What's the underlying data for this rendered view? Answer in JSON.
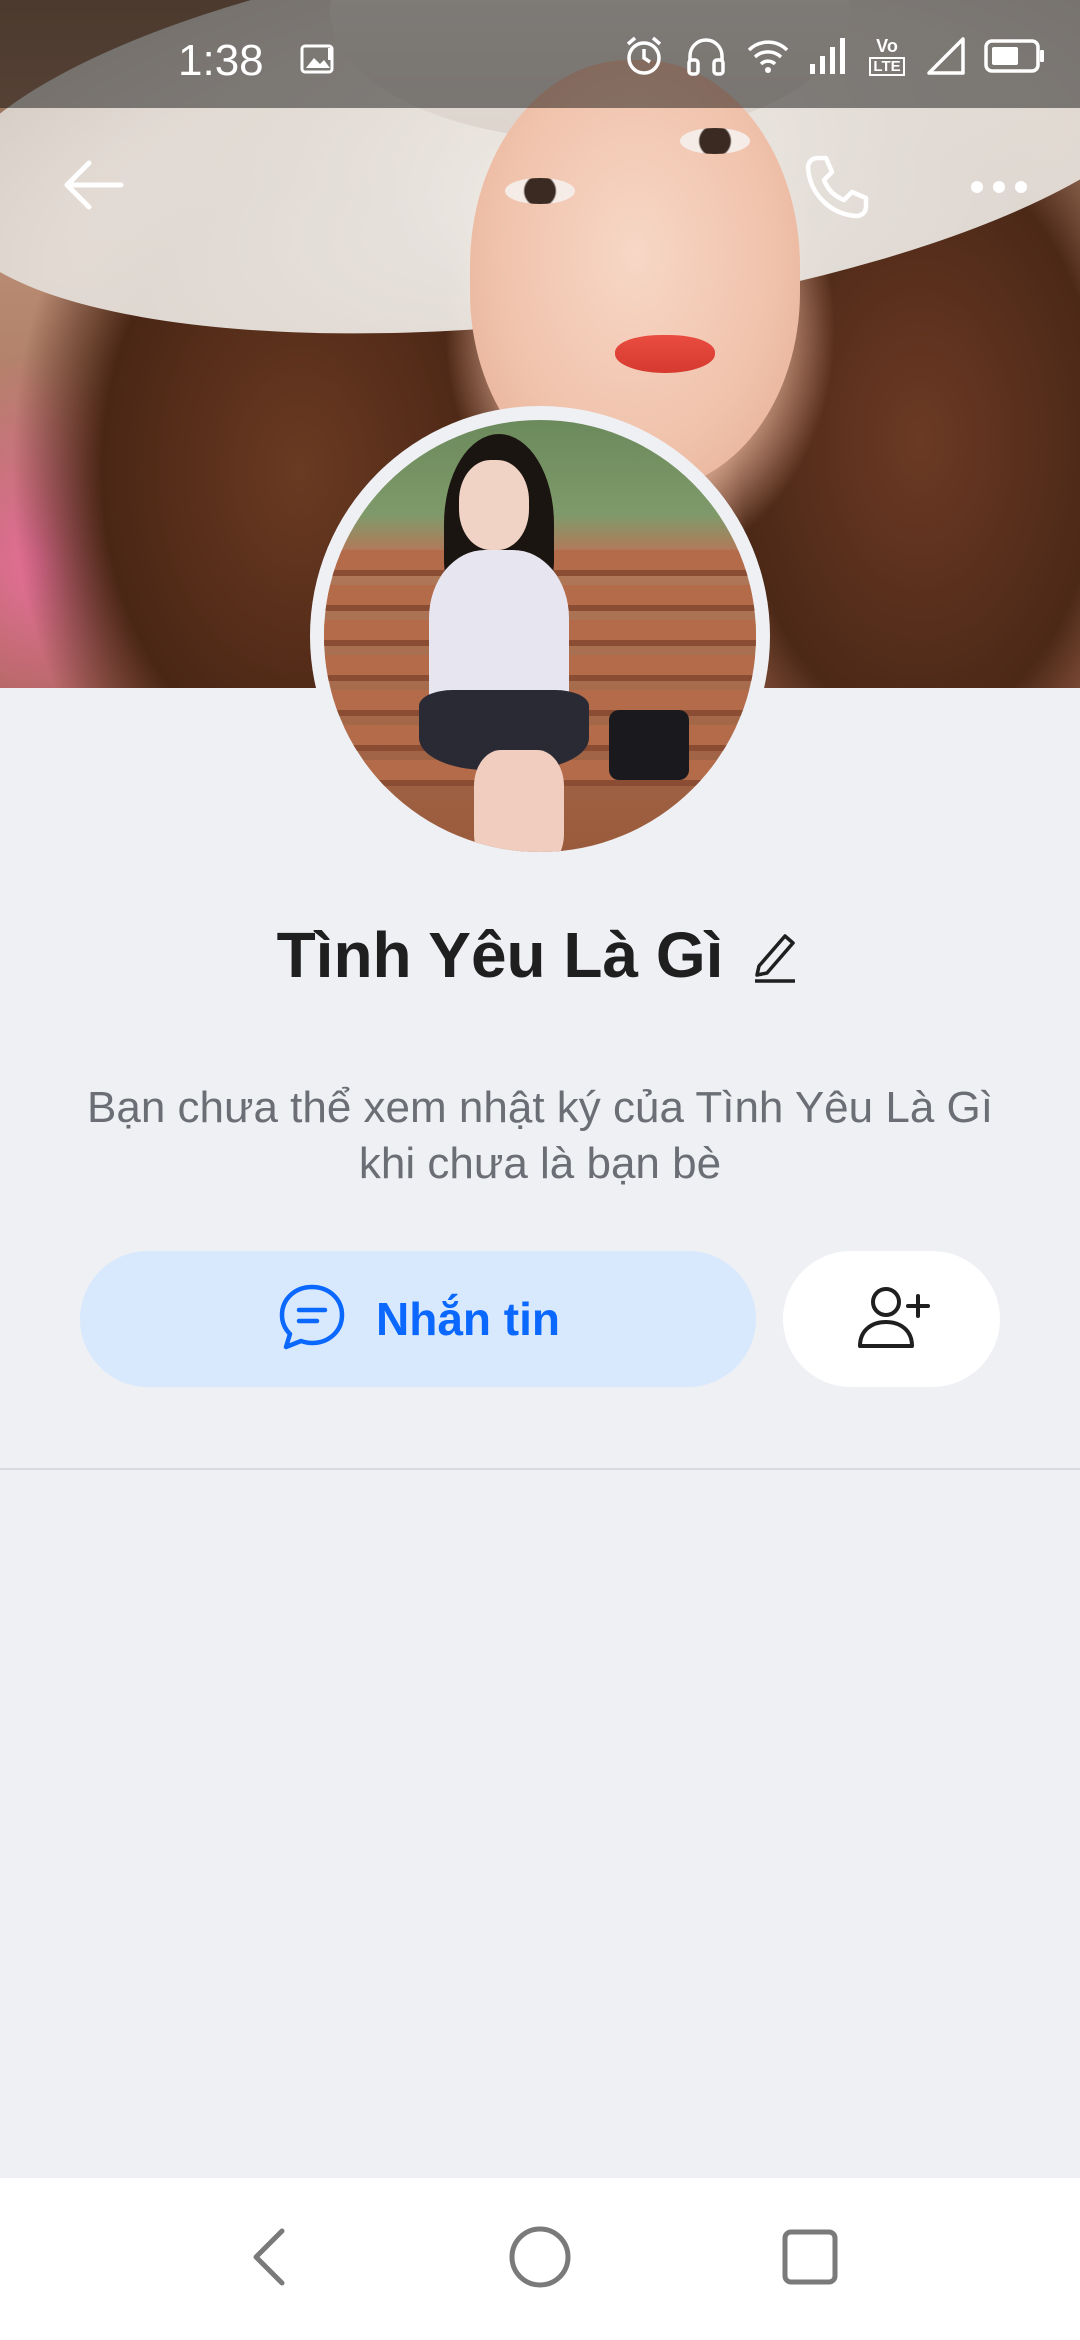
{
  "status_bar": {
    "time": "1:38",
    "icons": [
      "gallery-notification-icon",
      "alarm-icon",
      "headphones-icon",
      "wifi-icon",
      "cell-signal-icon",
      "volte-icon",
      "signal-empty-icon",
      "battery-icon"
    ],
    "volte_label_top": "Vo",
    "volte_label_bottom": "LTE"
  },
  "header": {
    "back_icon": "arrow-left-icon",
    "call_icon": "phone-icon",
    "more_icon": "more-dots-icon"
  },
  "profile": {
    "name": "Tình Yêu Là Gì",
    "edit_icon": "pencil-icon",
    "notice": "Bạn chưa thể xem nhật ký của Tình Yêu Là Gì khi chưa là bạn bè"
  },
  "actions": {
    "message_label": "Nhắn tin",
    "message_icon": "chat-bubble-icon",
    "add_friend_icon": "add-friend-icon"
  },
  "colors": {
    "accent": "#0a68ff",
    "message_button_bg": "#d8e8fd",
    "page_bg": "#eef0f4"
  },
  "system_nav": {
    "back_icon": "nav-back-icon",
    "home_icon": "nav-home-icon",
    "recents_icon": "nav-recents-icon"
  }
}
